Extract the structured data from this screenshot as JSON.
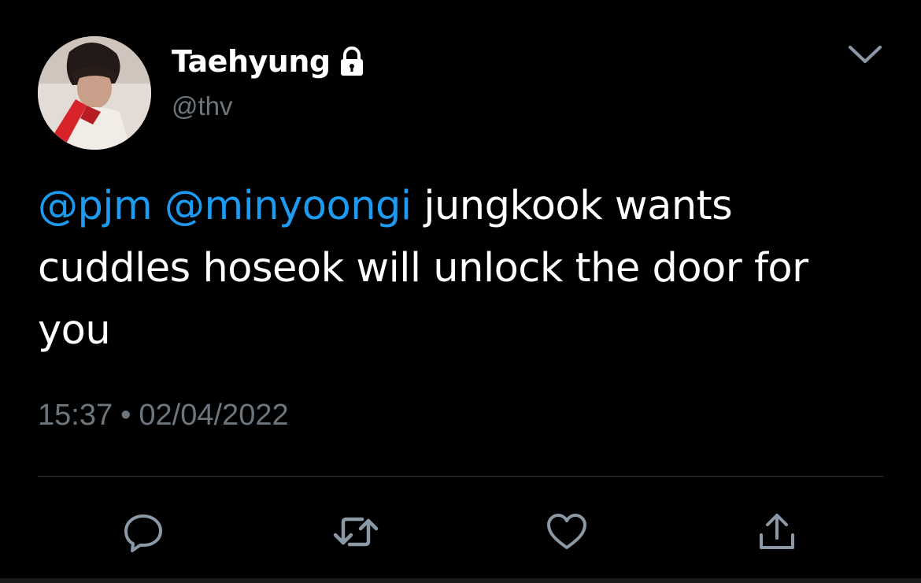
{
  "tweet": {
    "author": {
      "display_name": "Taehyung",
      "handle": "@thv",
      "protected_icon": "lock-icon",
      "avatar_icon": "avatar-photo"
    },
    "body": {
      "mentions": [
        "@pjm",
        "@minyoongi"
      ],
      "text": "jungkook wants cuddles hoseok will unlock the door for you"
    },
    "time": "15:37",
    "separator": "•",
    "date": "02/04/2022",
    "menu_icon": "chevron-down-icon",
    "actions": {
      "reply_icon": "reply-icon",
      "retweet_icon": "retweet-icon",
      "like_icon": "heart-icon",
      "share_icon": "share-icon"
    }
  },
  "colors": {
    "background": "#000000",
    "text_primary": "#ffffff",
    "text_secondary": "#6e767d",
    "accent": "#1d9bf0",
    "divider": "#2f3336",
    "icon": "#8b98a5"
  }
}
